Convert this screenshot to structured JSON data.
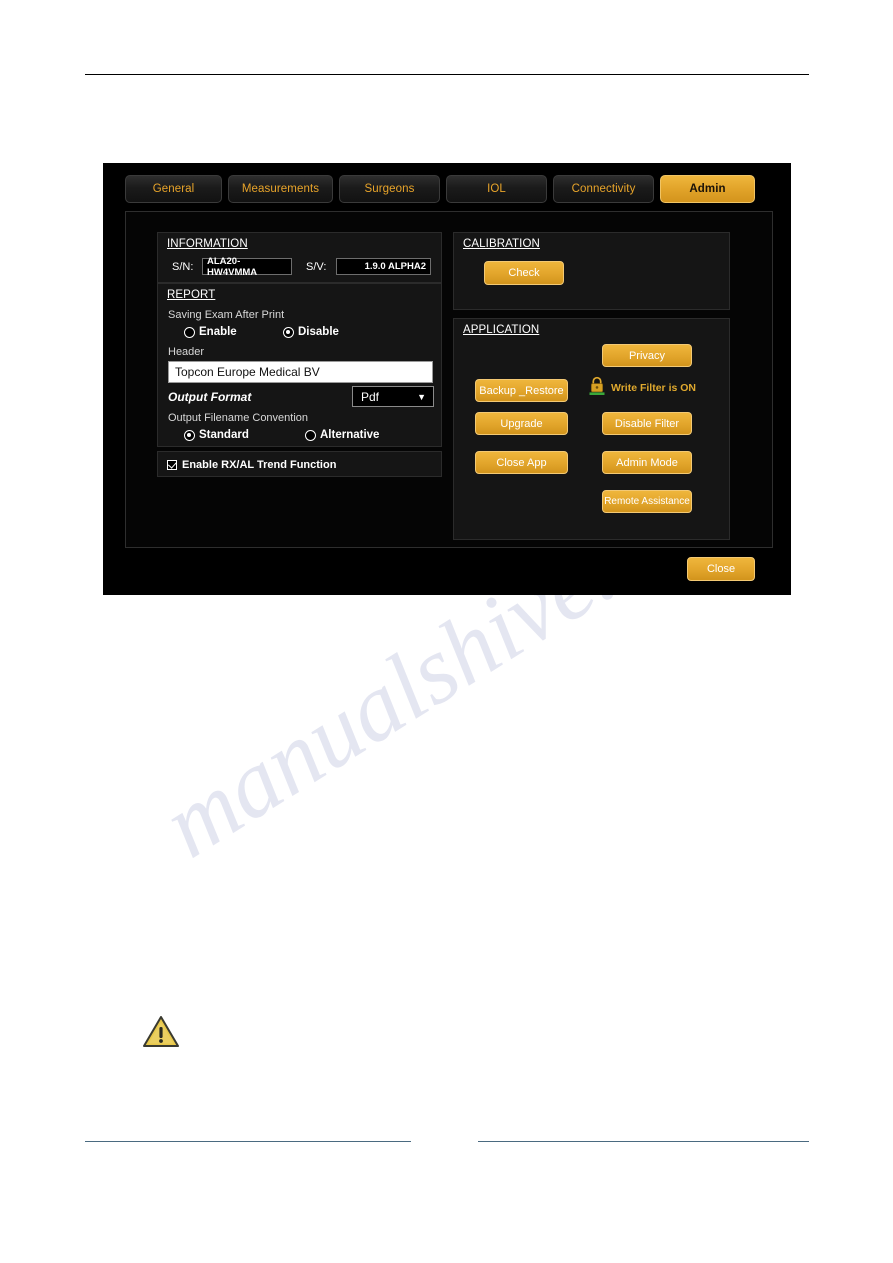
{
  "app": {
    "tabs": [
      {
        "label": "General",
        "active": false
      },
      {
        "label": "Measurements",
        "active": false
      },
      {
        "label": "Surgeons",
        "active": false
      },
      {
        "label": "IOL",
        "active": false
      },
      {
        "label": "Connectivity",
        "active": false
      },
      {
        "label": "Admin",
        "active": true
      }
    ],
    "information": {
      "title": "INFORMATION",
      "serial_label": "S/N:",
      "serial_value": "ALA20-HW4VMMA",
      "version_label": "S/V:",
      "version_value": "1.9.0 ALPHA2"
    },
    "report": {
      "title": "REPORT",
      "saving_exam_label": "Saving Exam After Print",
      "saving_options": [
        {
          "label": "Enable",
          "selected": false
        },
        {
          "label": "Disable",
          "selected": true
        }
      ],
      "header_label": "Header",
      "header_value": "Topcon Europe Medical BV",
      "output_format_label": "Output Format",
      "output_format_value": "Pdf",
      "filename_convention_label": "Output Filename Convention",
      "filename_options": [
        {
          "label": "Standard",
          "selected": true
        },
        {
          "label": "Alternative",
          "selected": false
        }
      ]
    },
    "trend": {
      "label": "Enable RX/AL Trend Function",
      "checked": true
    },
    "calibration": {
      "title": "CALIBRATION",
      "check_button": "Check"
    },
    "application": {
      "title": "APPLICATION",
      "privacy_button": "Privacy",
      "backup_restore_button": "Backup _Restore",
      "upgrade_button": "Upgrade",
      "close_app_button": "Close App",
      "disable_filter_button": "Disable Filter",
      "admin_mode_button": "Admin Mode",
      "remote_assistance_button": "Remote Assistance",
      "write_filter_status": "Write Filter is ON",
      "lock_icon": "padlock-icon"
    },
    "close_button": "Close"
  },
  "page": {
    "warning_icon": "warning-triangle-icon",
    "watermark_text": "manualshive.com"
  },
  "colors": {
    "accent_gold": "#e2a52b",
    "tab_text_gold": "#e8a42a",
    "status_gold": "#e0a92e",
    "window_background": "#000000",
    "group_background": "#151515",
    "lock_base_green": "#3aa83a",
    "footer_rule": "#4a6a80"
  }
}
